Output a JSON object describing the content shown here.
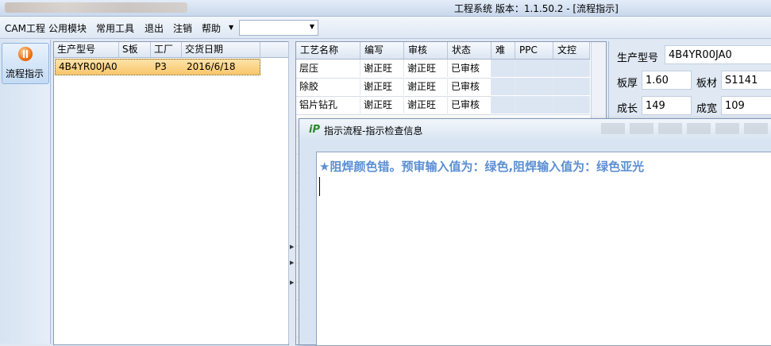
{
  "window": {
    "title": "工程系统   版本：1.1.50.2 - [流程指示]"
  },
  "menu": {
    "items": [
      "CAM工程",
      "公用模块",
      "常用工具",
      "退出",
      "注销",
      "帮助"
    ],
    "combo_value": ""
  },
  "nav": {
    "flow_button_label": "流程指示"
  },
  "order_table": {
    "columns": [
      "生产型号",
      "S板",
      "工厂",
      "交货日期"
    ],
    "rows": [
      {
        "model": "4B4YR00JA0",
        "s_board": "",
        "factory": "P3",
        "delivery_date": "2016/6/18"
      }
    ]
  },
  "process_table": {
    "columns": [
      "工艺名称",
      "编写",
      "审核",
      "状态",
      "难",
      "PPC",
      "文控"
    ],
    "rows": [
      {
        "name": "层压",
        "writer": "谢正旺",
        "reviewer": "谢正旺",
        "status": "已审核"
      },
      {
        "name": "除胶",
        "writer": "谢正旺",
        "reviewer": "谢正旺",
        "status": "已审核"
      },
      {
        "name": "铝片钻孔",
        "writer": "谢正旺",
        "reviewer": "谢正旺",
        "status": "已审核"
      }
    ]
  },
  "info": {
    "model_label": "生产型号",
    "model_value": "4B4YR00JA0",
    "thickness_label": "板厚",
    "thickness_value": "1.60",
    "material_label": "板材",
    "material_value": "S1141",
    "length_label": "成长",
    "length_value": "149",
    "width_label": "成宽",
    "width_value": "109"
  },
  "dialog": {
    "title": "指示流程-指示检查信息",
    "message": "★阻焊颜色错。预审输入值为：绿色,阻焊输入值为：绿色亚光"
  },
  "colors": {
    "accent": "#5b8fd3",
    "selection": "#f9c66a",
    "chrome": "#dfe8f3"
  },
  "icons": {
    "flow": "flow-indicator-icon",
    "dialog": "app-logo-icon"
  }
}
